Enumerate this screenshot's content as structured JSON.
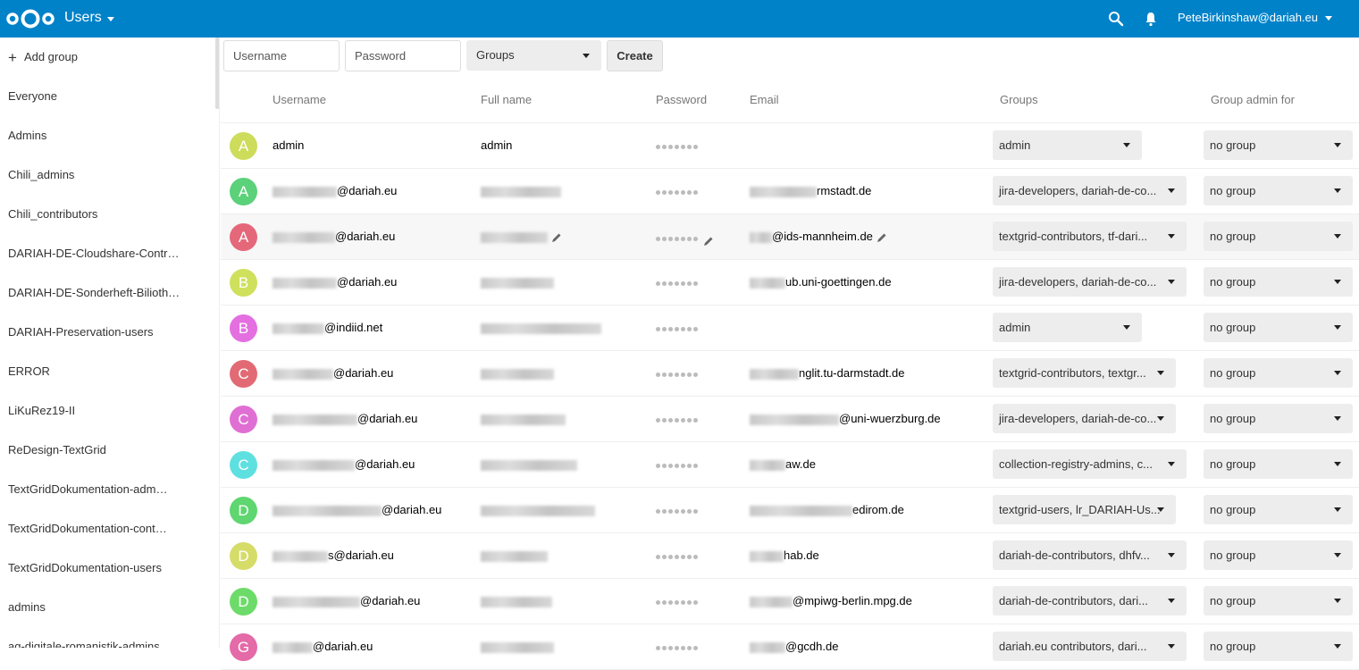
{
  "header": {
    "app_title": "Users",
    "user_name": "PeteBirkinshaw@dariah.eu"
  },
  "sidebar": {
    "add_group": "Add group",
    "groups": [
      "Everyone",
      "Admins",
      "Chili_admins",
      "Chili_contributors",
      "DARIAH-DE-Cloudshare-Contr…",
      "DARIAH-DE-Sonderheft-Bilioth…",
      "DARIAH-Preservation-users",
      "ERROR",
      "LiKuRez19-II",
      "ReDesign-TextGrid",
      "TextGridDokumentation-adm…",
      "TextGridDokumentation-cont…",
      "TextGridDokumentation-users",
      "admins",
      "ag-digitale-romanistik-admins"
    ]
  },
  "toolbar": {
    "username_placeholder": "Username",
    "password_placeholder": "Password",
    "groups_label": "Groups",
    "create_label": "Create"
  },
  "table": {
    "columns": {
      "username": "Username",
      "fullname": "Full name",
      "password": "Password",
      "email": "Email",
      "groups": "Groups",
      "group_admin": "Group admin for"
    },
    "rows": [
      {
        "initial": "A",
        "avatar_color": "#cddc5a",
        "username": "admin",
        "fullname": "admin",
        "email": "",
        "groups": "admin",
        "group_admin": "no group"
      },
      {
        "initial": "A",
        "avatar_color": "#5bd17a",
        "username": "@dariah.eu",
        "fullname": "",
        "email": "rmstadt.de",
        "groups": "jira-developers, dariah-de-co...",
        "group_admin": "no group"
      },
      {
        "initial": "A",
        "avatar_color": "#e5677a",
        "username": "@dariah.eu",
        "fullname": "",
        "email": "@ids-mannheim.de",
        "groups": "textgrid-contributors, tf-dari...",
        "group_admin": "no group"
      },
      {
        "initial": "B",
        "avatar_color": "#cfe05c",
        "username": "@dariah.eu",
        "fullname": "",
        "email": "ub.uni-goettingen.de",
        "groups": "jira-developers, dariah-de-co...",
        "group_admin": "no group"
      },
      {
        "initial": "B",
        "avatar_color": "#e46fe0",
        "username": "@indiid.net",
        "fullname": "",
        "email": "",
        "groups": "admin",
        "group_admin": "no group"
      },
      {
        "initial": "C",
        "avatar_color": "#e26a74",
        "username": "@dariah.eu",
        "fullname": "",
        "email": "nglit.tu-darmstadt.de",
        "groups": "textgrid-contributors, textgr...",
        "group_admin": "no group"
      },
      {
        "initial": "C",
        "avatar_color": "#e06fd3",
        "username": "@dariah.eu",
        "fullname": "",
        "email": "@uni-wuerzburg.de",
        "groups": "jira-developers, dariah-de-co...",
        "group_admin": "no group"
      },
      {
        "initial": "C",
        "avatar_color": "#5fe0e0",
        "username": "@dariah.eu",
        "fullname": "",
        "email": "aw.de",
        "groups": "collection-registry-admins, c...",
        "group_admin": "no group"
      },
      {
        "initial": "D",
        "avatar_color": "#5fd670",
        "username": "@dariah.eu",
        "fullname": "",
        "email": "edirom.de",
        "groups": "textgrid-users, lr_DARIAH-Us...",
        "group_admin": "no group"
      },
      {
        "initial": "D",
        "avatar_color": "#d6dc68",
        "username": "s@dariah.eu",
        "fullname": "",
        "email": "hab.de",
        "groups": "dariah-de-contributors, dhfv...",
        "group_admin": "no group"
      },
      {
        "initial": "D",
        "avatar_color": "#6ddb6a",
        "username": "@dariah.eu",
        "fullname": "",
        "email": "@mpiwg-berlin.mpg.de",
        "groups": "dariah-de-contributors, dari...",
        "group_admin": "no group"
      },
      {
        "initial": "G",
        "avatar_color": "#e46aa8",
        "username": "@dariah.eu",
        "fullname": "",
        "email": "@gcdh.de",
        "groups": "dariah.eu contributors, dari...",
        "group_admin": "no group"
      }
    ]
  }
}
